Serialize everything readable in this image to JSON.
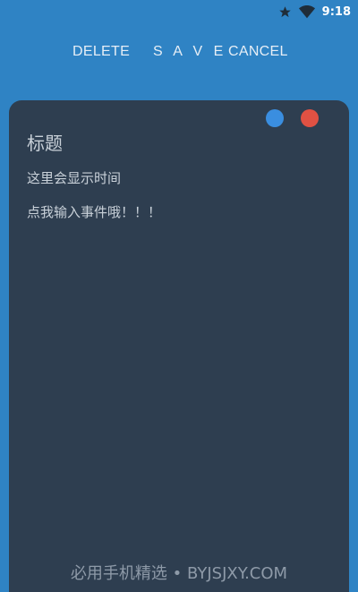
{
  "status_bar": {
    "time": "9:18",
    "icons": [
      "star-icon",
      "wifi-icon"
    ]
  },
  "toolbar": {
    "delete_label": "DELETE",
    "save_label": "S A V E",
    "cancel_label": "CANCEL"
  },
  "note": {
    "title": "标题",
    "time": "这里会显示时间",
    "body": "点我输入事件哦！！！",
    "color_options": [
      "#3a8ee0",
      "#e05143"
    ]
  },
  "colors": {
    "background": "#2f83c4",
    "card": "#2e3e50",
    "text": "#c9d1d9"
  },
  "watermark": "必用手机精选 • BYJSJXY.COM"
}
